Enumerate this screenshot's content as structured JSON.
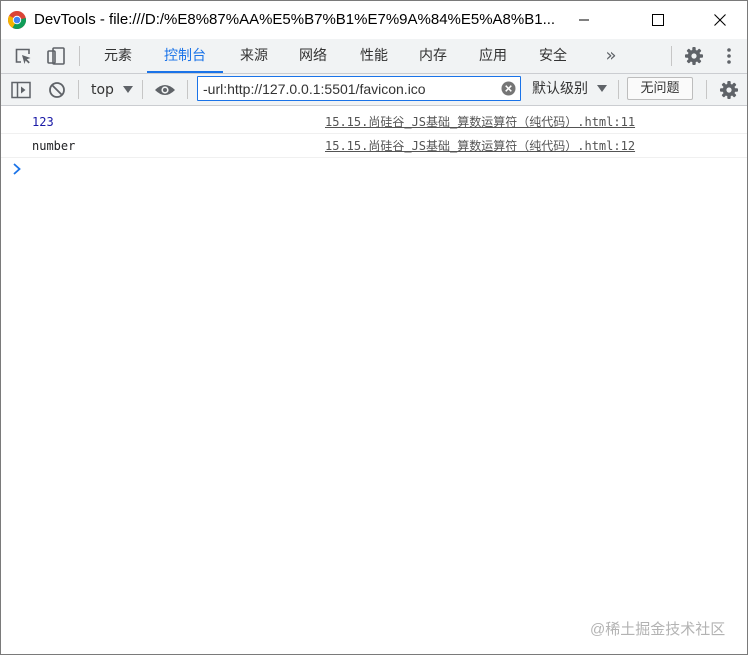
{
  "window": {
    "title": "DevTools - file:///D:/%E8%87%AA%E5%B7%B1%E7%9A%84%E5%A8%B1...",
    "controls": [
      "minimize",
      "maximize",
      "close"
    ]
  },
  "tabs": {
    "items": [
      {
        "label": "元素",
        "active": false
      },
      {
        "label": "控制台",
        "active": true
      },
      {
        "label": "来源",
        "active": false
      },
      {
        "label": "网络",
        "active": false
      },
      {
        "label": "性能",
        "active": false
      },
      {
        "label": "内存",
        "active": false
      },
      {
        "label": "应用",
        "active": false
      },
      {
        "label": "安全",
        "active": false
      }
    ],
    "more_label": "»"
  },
  "toolbar": {
    "context": "top",
    "filter_value": "-url:http://127.0.0.1:5501/favicon.ico",
    "levels_label": "默认级别",
    "issues_label": "无问题"
  },
  "console": {
    "messages": [
      {
        "text": "123",
        "kind": "number",
        "source": "15.15.尚硅谷_JS基础_算数运算符（纯代码）.html:11"
      },
      {
        "text": "number",
        "kind": "string",
        "source": "15.15.尚硅谷_JS基础_算数运算符（纯代码）.html:12"
      }
    ],
    "prompt_symbol": "›"
  },
  "watermark": "@稀土掘金技术社区",
  "colors": {
    "accent": "#1a73e8",
    "toolbar_bg": "#f1f3f4",
    "number_value": "#1a1aa6"
  },
  "icons": [
    "chrome-logo-icon",
    "inspect-element-icon",
    "device-toggle-icon",
    "settings-gear-icon",
    "more-vertical-icon",
    "sidebar-toggle-icon",
    "clear-console-icon",
    "dropdown-arrow-icon",
    "eye-icon",
    "clear-filter-icon",
    "console-prompt-icon"
  ]
}
